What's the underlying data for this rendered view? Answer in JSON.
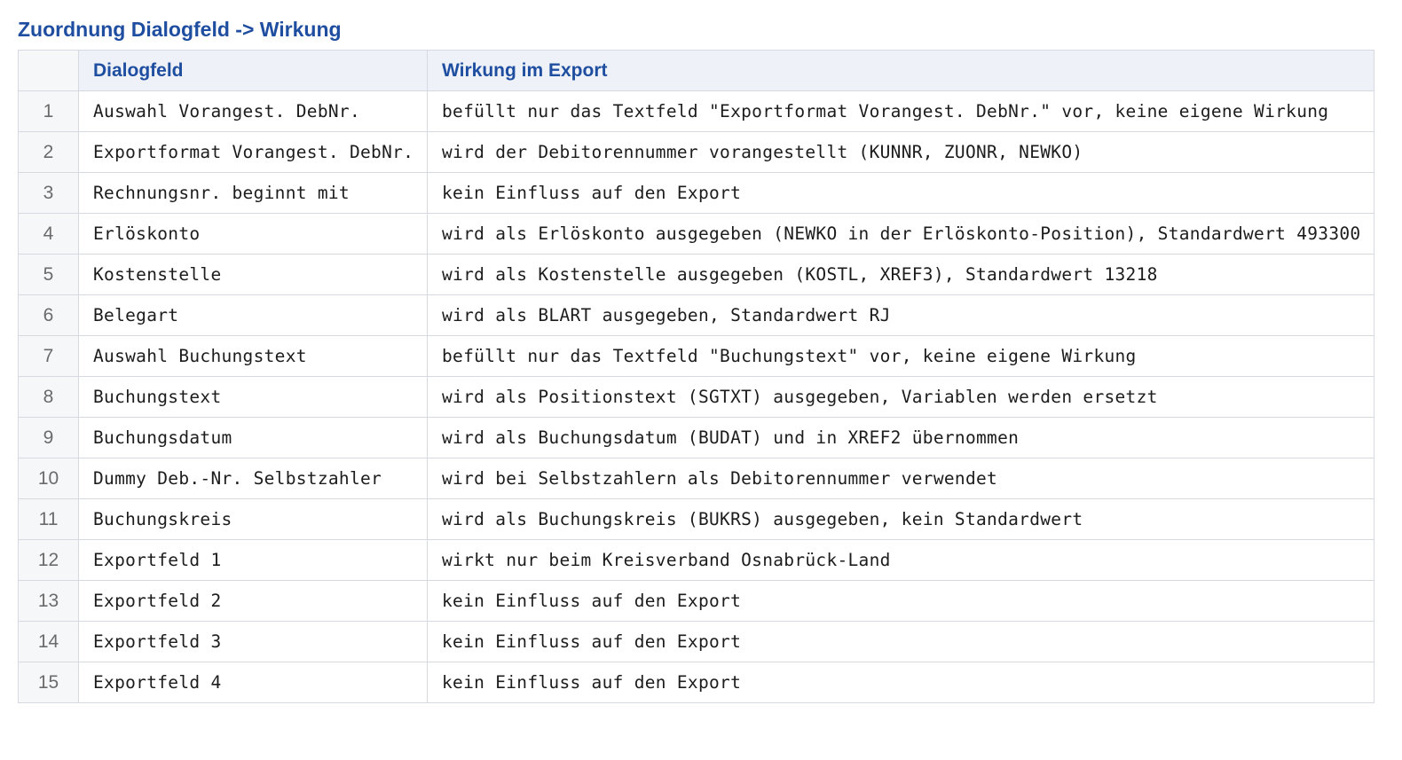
{
  "page": {
    "title": "Zuordnung Dialogfeld -> Wirkung"
  },
  "table": {
    "headers": {
      "number": "",
      "field": "Dialogfeld",
      "effect": "Wirkung im Export"
    },
    "rows": [
      {
        "num": "1",
        "field": "Auswahl Vorangest. DebNr.",
        "effect": "befüllt nur das Textfeld \"Exportformat Vorangest. DebNr.\" vor, keine eigene Wirkung"
      },
      {
        "num": "2",
        "field": "Exportformat Vorangest. DebNr.",
        "effect": "wird der Debitorennummer vorangestellt (KUNNR, ZUONR, NEWKO)"
      },
      {
        "num": "3",
        "field": "Rechnungsnr. beginnt mit",
        "effect": "kein Einfluss auf den Export"
      },
      {
        "num": "4",
        "field": "Erlöskonto",
        "effect": "wird als Erlöskonto ausgegeben (NEWKO in der Erlöskonto-Position), Standardwert 493300"
      },
      {
        "num": "5",
        "field": "Kostenstelle",
        "effect": "wird als Kostenstelle ausgegeben (KOSTL, XREF3), Standardwert 13218"
      },
      {
        "num": "6",
        "field": "Belegart",
        "effect": "wird als BLART ausgegeben, Standardwert RJ"
      },
      {
        "num": "7",
        "field": "Auswahl Buchungstext",
        "effect": "befüllt nur das Textfeld \"Buchungstext\" vor, keine eigene Wirkung"
      },
      {
        "num": "8",
        "field": "Buchungstext",
        "effect": "wird als Positionstext (SGTXT) ausgegeben, Variablen werden ersetzt"
      },
      {
        "num": "9",
        "field": "Buchungsdatum",
        "effect": "wird als Buchungsdatum (BUDAT) und in XREF2 übernommen"
      },
      {
        "num": "10",
        "field": "Dummy Deb.-Nr. Selbstzahler",
        "effect": "wird bei Selbstzahlern als Debitorennummer verwendet"
      },
      {
        "num": "11",
        "field": "Buchungskreis",
        "effect": "wird als Buchungskreis (BUKRS) ausgegeben, kein Standardwert"
      },
      {
        "num": "12",
        "field": "Exportfeld 1",
        "effect": "wirkt nur beim Kreisverband Osnabrück-Land"
      },
      {
        "num": "13",
        "field": "Exportfeld 2",
        "effect": "kein Einfluss auf den Export"
      },
      {
        "num": "14",
        "field": "Exportfeld 3",
        "effect": "kein Einfluss auf den Export"
      },
      {
        "num": "15",
        "field": "Exportfeld 4",
        "effect": "kein Einfluss auf den Export"
      }
    ]
  },
  "colors": {
    "title": "#1f4ea1",
    "header_bg": "#eef2f8",
    "index_bg": "#f6f7f9",
    "border": "#d6dae0"
  }
}
